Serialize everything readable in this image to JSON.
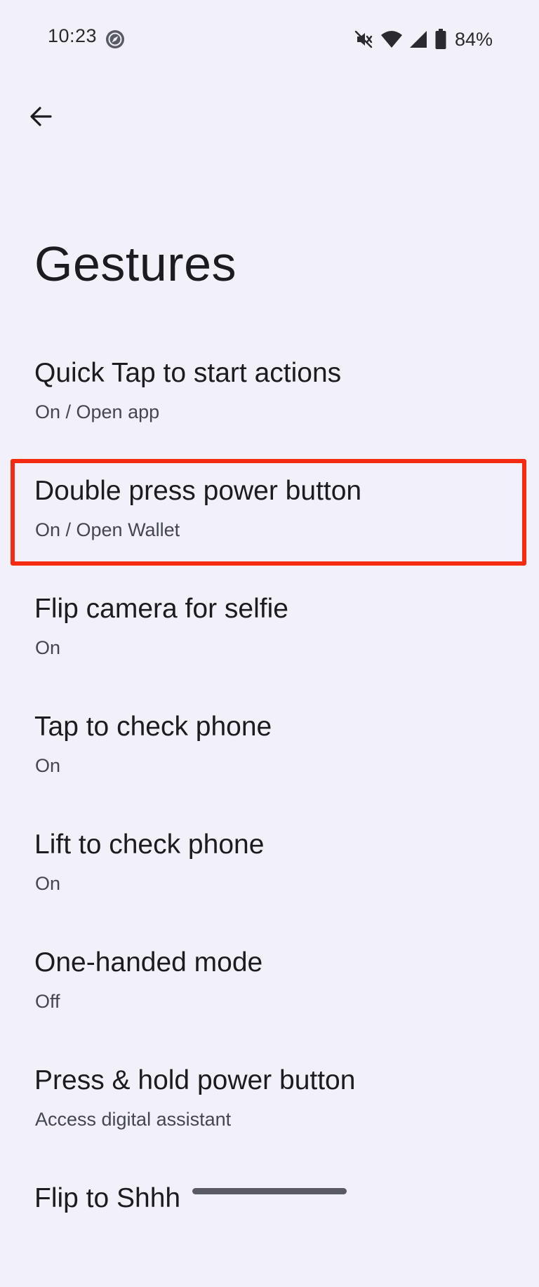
{
  "status_bar": {
    "time": "10:23",
    "battery_percent": "84%",
    "icons": [
      "compass-icon",
      "mute-icon",
      "wifi-icon",
      "cell-signal-icon",
      "battery-icon"
    ]
  },
  "header": {
    "back_icon": "arrow-back-icon",
    "title": "Gestures"
  },
  "settings": [
    {
      "title": "Quick Tap to start actions",
      "summary": "On / Open app"
    },
    {
      "title": "Double press power button",
      "summary": "On / Open Wallet",
      "highlighted": true
    },
    {
      "title": "Flip camera for selfie",
      "summary": "On"
    },
    {
      "title": "Tap to check phone",
      "summary": "On"
    },
    {
      "title": "Lift to check phone",
      "summary": "On"
    },
    {
      "title": "One-handed mode",
      "summary": "Off"
    },
    {
      "title": "Press & hold power button",
      "summary": "Access digital assistant"
    },
    {
      "title": "Flip to Shhh",
      "summary": ""
    }
  ],
  "colors": {
    "background": "#F2F1FA",
    "highlight": "#F42A12",
    "text_primary": "#1B1B21",
    "text_secondary": "#46464F"
  }
}
